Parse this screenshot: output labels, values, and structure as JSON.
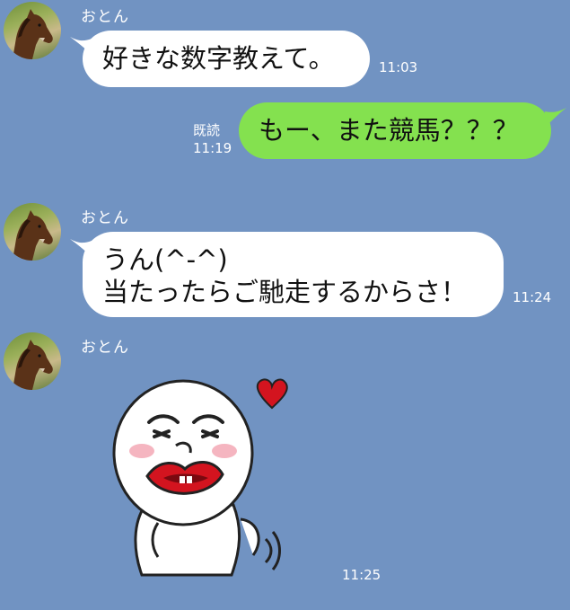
{
  "colors": {
    "background": "#7193c2",
    "incoming_bubble": "#ffffff",
    "outgoing_bubble": "#84e14f",
    "meta_text": "#ffffff"
  },
  "messages": [
    {
      "direction": "incoming",
      "sender": "おとん",
      "avatar_icon": "horse-avatar-icon",
      "text": "好きな数字教えて。",
      "time": "11:03"
    },
    {
      "direction": "outgoing",
      "read_label": "既読",
      "text": "もー、また競馬？？？",
      "time": "11:19"
    },
    {
      "direction": "incoming",
      "sender": "おとん",
      "avatar_icon": "horse-avatar-icon",
      "lines": [
        "うん(^-^)",
        "当たったらご馳走するからさ！"
      ],
      "time": "11:24"
    },
    {
      "direction": "incoming",
      "sender": "おとん",
      "avatar_icon": "horse-avatar-icon",
      "sticker_icon": "moon-kiss-sticker-icon",
      "time": "11:25"
    }
  ]
}
